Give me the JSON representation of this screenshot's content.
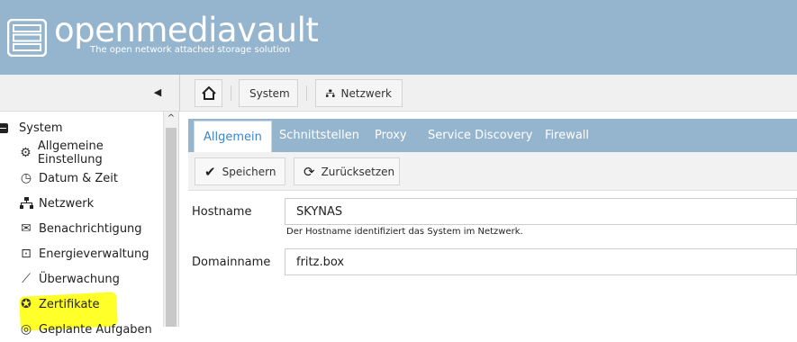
{
  "header": {
    "brand": "openmediavault",
    "tagline": "The open network attached storage solution"
  },
  "toolbar": {
    "collapse_icon": "triangle-left-icon",
    "breadcrumbs": [
      {
        "icon": "home-icon",
        "label": ""
      },
      {
        "icon": "",
        "label": "System"
      },
      {
        "icon": "network-icon",
        "label": "Netzwerk"
      }
    ]
  },
  "sidebar": {
    "group": {
      "label": "System",
      "icon": "minus-icon"
    },
    "items": [
      {
        "label": "Allgemeine Einstellung",
        "icon": "gears-icon"
      },
      {
        "label": "Datum & Zeit",
        "icon": "clock-icon"
      },
      {
        "label": "Netzwerk",
        "icon": "network-icon",
        "highlighted": true
      },
      {
        "label": "Benachrichtigung",
        "icon": "envelope-icon"
      },
      {
        "label": "Energieverwaltung",
        "icon": "power-icon"
      },
      {
        "label": "Überwachung",
        "icon": "chart-line-icon"
      },
      {
        "label": "Zertifikate",
        "icon": "certificate-icon"
      },
      {
        "label": "Geplante Aufgaben",
        "icon": "schedule-icon"
      }
    ]
  },
  "tabs": [
    {
      "label": "Allgemein",
      "active": true
    },
    {
      "label": "Schnittstellen",
      "active": false
    },
    {
      "label": "Proxy",
      "active": false
    },
    {
      "label": "Service Discovery",
      "active": false
    },
    {
      "label": "Firewall",
      "active": false
    }
  ],
  "actions": {
    "save": {
      "label": "Speichern",
      "icon": "checkmark-icon"
    },
    "reset": {
      "label": "Zurücksetzen",
      "icon": "refresh-icon"
    }
  },
  "form": {
    "hostname": {
      "label": "Hostname",
      "value": "SKYNAS",
      "hint": "Der Hostname identifiziert das System im Netzwerk."
    },
    "domainname": {
      "label": "Domainname",
      "value": "fritz.box"
    }
  },
  "colors": {
    "header_bg": "#95b4ce",
    "active_tab_text": "#3a86c8",
    "highlight": "#ffff2a"
  }
}
